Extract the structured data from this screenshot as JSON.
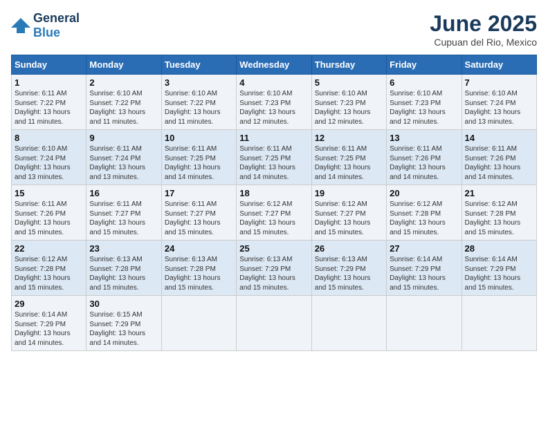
{
  "logo": {
    "general": "General",
    "blue": "Blue"
  },
  "title": "June 2025",
  "location": "Cupuan del Rio, Mexico",
  "days_of_week": [
    "Sunday",
    "Monday",
    "Tuesday",
    "Wednesday",
    "Thursday",
    "Friday",
    "Saturday"
  ],
  "weeks": [
    [
      {
        "day": "1",
        "sunrise": "Sunrise: 6:11 AM",
        "sunset": "Sunset: 7:22 PM",
        "daylight": "Daylight: 13 hours and 11 minutes."
      },
      {
        "day": "2",
        "sunrise": "Sunrise: 6:10 AM",
        "sunset": "Sunset: 7:22 PM",
        "daylight": "Daylight: 13 hours and 11 minutes."
      },
      {
        "day": "3",
        "sunrise": "Sunrise: 6:10 AM",
        "sunset": "Sunset: 7:22 PM",
        "daylight": "Daylight: 13 hours and 11 minutes."
      },
      {
        "day": "4",
        "sunrise": "Sunrise: 6:10 AM",
        "sunset": "Sunset: 7:23 PM",
        "daylight": "Daylight: 13 hours and 12 minutes."
      },
      {
        "day": "5",
        "sunrise": "Sunrise: 6:10 AM",
        "sunset": "Sunset: 7:23 PM",
        "daylight": "Daylight: 13 hours and 12 minutes."
      },
      {
        "day": "6",
        "sunrise": "Sunrise: 6:10 AM",
        "sunset": "Sunset: 7:23 PM",
        "daylight": "Daylight: 13 hours and 12 minutes."
      },
      {
        "day": "7",
        "sunrise": "Sunrise: 6:10 AM",
        "sunset": "Sunset: 7:24 PM",
        "daylight": "Daylight: 13 hours and 13 minutes."
      }
    ],
    [
      {
        "day": "8",
        "sunrise": "Sunrise: 6:10 AM",
        "sunset": "Sunset: 7:24 PM",
        "daylight": "Daylight: 13 hours and 13 minutes."
      },
      {
        "day": "9",
        "sunrise": "Sunrise: 6:11 AM",
        "sunset": "Sunset: 7:24 PM",
        "daylight": "Daylight: 13 hours and 13 minutes."
      },
      {
        "day": "10",
        "sunrise": "Sunrise: 6:11 AM",
        "sunset": "Sunset: 7:25 PM",
        "daylight": "Daylight: 13 hours and 14 minutes."
      },
      {
        "day": "11",
        "sunrise": "Sunrise: 6:11 AM",
        "sunset": "Sunset: 7:25 PM",
        "daylight": "Daylight: 13 hours and 14 minutes."
      },
      {
        "day": "12",
        "sunrise": "Sunrise: 6:11 AM",
        "sunset": "Sunset: 7:25 PM",
        "daylight": "Daylight: 13 hours and 14 minutes."
      },
      {
        "day": "13",
        "sunrise": "Sunrise: 6:11 AM",
        "sunset": "Sunset: 7:26 PM",
        "daylight": "Daylight: 13 hours and 14 minutes."
      },
      {
        "day": "14",
        "sunrise": "Sunrise: 6:11 AM",
        "sunset": "Sunset: 7:26 PM",
        "daylight": "Daylight: 13 hours and 14 minutes."
      }
    ],
    [
      {
        "day": "15",
        "sunrise": "Sunrise: 6:11 AM",
        "sunset": "Sunset: 7:26 PM",
        "daylight": "Daylight: 13 hours and 15 minutes."
      },
      {
        "day": "16",
        "sunrise": "Sunrise: 6:11 AM",
        "sunset": "Sunset: 7:27 PM",
        "daylight": "Daylight: 13 hours and 15 minutes."
      },
      {
        "day": "17",
        "sunrise": "Sunrise: 6:11 AM",
        "sunset": "Sunset: 7:27 PM",
        "daylight": "Daylight: 13 hours and 15 minutes."
      },
      {
        "day": "18",
        "sunrise": "Sunrise: 6:12 AM",
        "sunset": "Sunset: 7:27 PM",
        "daylight": "Daylight: 13 hours and 15 minutes."
      },
      {
        "day": "19",
        "sunrise": "Sunrise: 6:12 AM",
        "sunset": "Sunset: 7:27 PM",
        "daylight": "Daylight: 13 hours and 15 minutes."
      },
      {
        "day": "20",
        "sunrise": "Sunrise: 6:12 AM",
        "sunset": "Sunset: 7:28 PM",
        "daylight": "Daylight: 13 hours and 15 minutes."
      },
      {
        "day": "21",
        "sunrise": "Sunrise: 6:12 AM",
        "sunset": "Sunset: 7:28 PM",
        "daylight": "Daylight: 13 hours and 15 minutes."
      }
    ],
    [
      {
        "day": "22",
        "sunrise": "Sunrise: 6:12 AM",
        "sunset": "Sunset: 7:28 PM",
        "daylight": "Daylight: 13 hours and 15 minutes."
      },
      {
        "day": "23",
        "sunrise": "Sunrise: 6:13 AM",
        "sunset": "Sunset: 7:28 PM",
        "daylight": "Daylight: 13 hours and 15 minutes."
      },
      {
        "day": "24",
        "sunrise": "Sunrise: 6:13 AM",
        "sunset": "Sunset: 7:28 PM",
        "daylight": "Daylight: 13 hours and 15 minutes."
      },
      {
        "day": "25",
        "sunrise": "Sunrise: 6:13 AM",
        "sunset": "Sunset: 7:29 PM",
        "daylight": "Daylight: 13 hours and 15 minutes."
      },
      {
        "day": "26",
        "sunrise": "Sunrise: 6:13 AM",
        "sunset": "Sunset: 7:29 PM",
        "daylight": "Daylight: 13 hours and 15 minutes."
      },
      {
        "day": "27",
        "sunrise": "Sunrise: 6:14 AM",
        "sunset": "Sunset: 7:29 PM",
        "daylight": "Daylight: 13 hours and 15 minutes."
      },
      {
        "day": "28",
        "sunrise": "Sunrise: 6:14 AM",
        "sunset": "Sunset: 7:29 PM",
        "daylight": "Daylight: 13 hours and 15 minutes."
      }
    ],
    [
      {
        "day": "29",
        "sunrise": "Sunrise: 6:14 AM",
        "sunset": "Sunset: 7:29 PM",
        "daylight": "Daylight: 13 hours and 14 minutes."
      },
      {
        "day": "30",
        "sunrise": "Sunrise: 6:15 AM",
        "sunset": "Sunset: 7:29 PM",
        "daylight": "Daylight: 13 hours and 14 minutes."
      },
      null,
      null,
      null,
      null,
      null
    ]
  ]
}
